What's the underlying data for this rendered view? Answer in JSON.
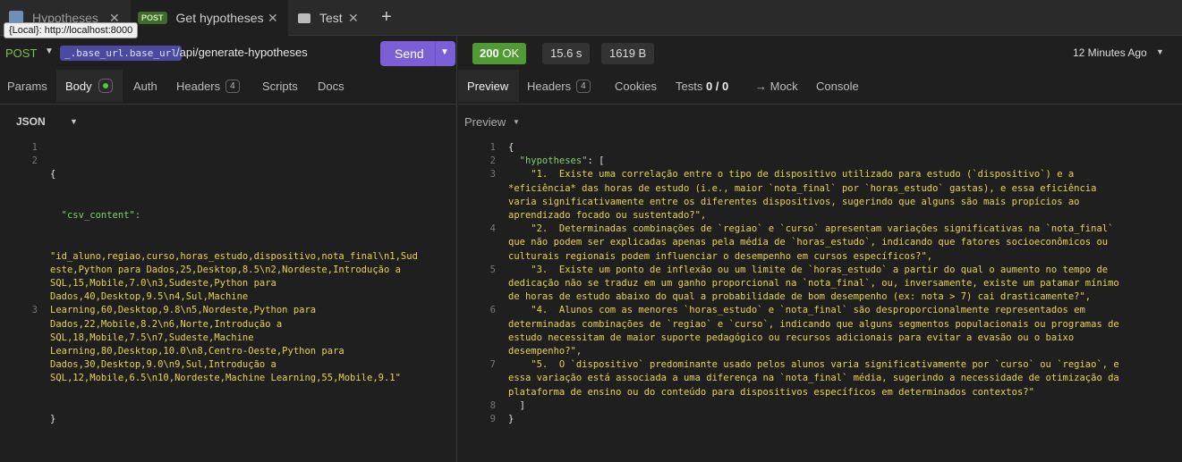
{
  "tabs": [
    {
      "label": "Hypotheses"
    },
    {
      "badge": "POST",
      "label": "Get hypotheses"
    },
    {
      "label": "Test"
    }
  ],
  "tooltip": "{Local}: http://localhost:8000",
  "request": {
    "method": "POST",
    "env_var": "_.base_url.base_url",
    "path": "/api/generate-hypotheses",
    "send_label": "Send",
    "subtabs": {
      "params": "Params",
      "body": "Body",
      "auth": "Auth",
      "headers": "Headers",
      "headers_count": "4",
      "scripts": "Scripts",
      "docs": "Docs"
    },
    "body_format": "JSON",
    "line_numbers": [
      "1",
      "2",
      "",
      "",
      "",
      "",
      "",
      "",
      "",
      "",
      "",
      "",
      "3"
    ],
    "code": {
      "open": "{",
      "key": "\"csv_content\":",
      "value_lines": [
        "\"id_aluno,regiao,curso,horas_estudo,dispositivo,nota_final\\n1,Sud",
        "este,Python para Dados,25,Desktop,8.5\\n2,Nordeste,Introdução a",
        "SQL,15,Mobile,7.0\\n3,Sudeste,Python para",
        "Dados,40,Desktop,9.5\\n4,Sul,Machine",
        "Learning,60,Desktop,9.8\\n5,Nordeste,Python para",
        "Dados,22,Mobile,8.2\\n6,Norte,Introdução a",
        "SQL,18,Mobile,7.5\\n7,Sudeste,Machine",
        "Learning,80,Desktop,10.0\\n8,Centro-Oeste,Python para",
        "Dados,30,Desktop,9.0\\n9,Sul,Introdução a",
        "SQL,12,Mobile,6.5\\n10,Nordeste,Machine Learning,55,Mobile,9.1\""
      ],
      "close": "}"
    }
  },
  "response": {
    "status_code": "200",
    "status_text": "OK",
    "time": "15.6 s",
    "size": "1619 B",
    "ago": "12 Minutes Ago",
    "subtabs": {
      "preview": "Preview",
      "headers": "Headers",
      "headers_count": "4",
      "cookies": "Cookies",
      "tests": "Tests",
      "tests_count": "0 / 0",
      "mock": "→ Mock",
      "console": "Console"
    },
    "preview_label": "Preview",
    "code_lines": [
      {
        "n": "1",
        "text": "{"
      },
      {
        "n": "2",
        "text": "  \"hypotheses\": ["
      },
      {
        "n": "3",
        "text": "    \"1.  Existe uma correlação entre o tipo de dispositivo utilizado para estudo (`dispositivo`) e a"
      },
      {
        "n": "",
        "text": "*eficiência* das horas de estudo (i.e., maior `nota_final` por `horas_estudo` gastas), e essa eficiência"
      },
      {
        "n": "",
        "text": "varia significativamente entre os diferentes dispositivos, sugerindo que alguns são mais propícios ao"
      },
      {
        "n": "",
        "text": "aprendizado focado ou sustentado?\","
      },
      {
        "n": "4",
        "text": "    \"2.  Determinadas combinações de `regiao` e `curso` apresentam variações significativas na `nota_final`"
      },
      {
        "n": "",
        "text": "que não podem ser explicadas apenas pela média de `horas_estudo`, indicando que fatores socioeconômicos ou"
      },
      {
        "n": "",
        "text": "culturais regionais podem influenciar o desempenho em cursos específicos?\","
      },
      {
        "n": "5",
        "text": "    \"3.  Existe um ponto de inflexão ou um limite de `horas_estudo` a partir do qual o aumento no tempo de"
      },
      {
        "n": "",
        "text": "dedicação não se traduz em um ganho proporcional na `nota_final`, ou, inversamente, existe um patamar mínimo"
      },
      {
        "n": "",
        "text": "de horas de estudo abaixo do qual a probabilidade de bom desempenho (ex: nota > 7) cai drasticamente?\","
      },
      {
        "n": "6",
        "text": "    \"4.  Alunos com as menores `horas_estudo` e `nota_final` são desproporcionalmente representados em"
      },
      {
        "n": "",
        "text": "determinadas combinações de `regiao` e `curso`, indicando que alguns segmentos populacionais ou programas de"
      },
      {
        "n": "",
        "text": "estudo necessitam de maior suporte pedagógico ou recursos adicionais para evitar a evasão ou o baixo"
      },
      {
        "n": "",
        "text": "desempenho?\","
      },
      {
        "n": "7",
        "text": "    \"5.  O `dispositivo` predominante usado pelos alunos varia significativamente por `curso` ou `regiao`, e"
      },
      {
        "n": "",
        "text": "essa variação está associada a uma diferença na `nota_final` média, sugerindo a necessidade de otimização da"
      },
      {
        "n": "",
        "text": "plataforma de ensino ou do conteúdo para dispositivos específicos em determinados contextos?\""
      },
      {
        "n": "8",
        "text": "  ]"
      },
      {
        "n": "9",
        "text": "}"
      }
    ]
  },
  "colors": {
    "accent": "#7a5fd6",
    "ok": "#4f9a32",
    "method": "#7bc04a",
    "string": "#e8d44d"
  }
}
